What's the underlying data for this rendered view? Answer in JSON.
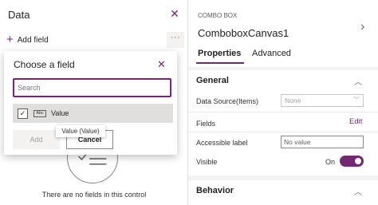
{
  "data_pane": {
    "title": "Data",
    "add_field_label": "Add field",
    "more_label": "···",
    "empty_text": "There are no fields in this control"
  },
  "dialog": {
    "title": "Choose a field",
    "search_placeholder": "Search",
    "field_type": "Abc",
    "field_label": "Value",
    "checked": "✓",
    "add_label": "Add",
    "cancel_label": "Cancel",
    "tooltip": "Value (Value)"
  },
  "properties": {
    "control_type": "COMBO BOX",
    "control_name": "ComboboxCanvas1",
    "tabs": [
      {
        "label": "Properties",
        "active": true
      },
      {
        "label": "Advanced",
        "active": false
      }
    ],
    "general": {
      "title": "General",
      "data_source_label": "Data Source(Items)",
      "data_source_value": "None",
      "fields_label": "Fields",
      "fields_action": "Edit",
      "accessible_label": "Accessible label",
      "accessible_value": "No value",
      "visible_label": "Visible",
      "visible_state": "On"
    },
    "behavior": {
      "title": "Behavior"
    }
  },
  "colors": {
    "accent": "#742774",
    "pane_background": "#f3f2f1"
  },
  "icons": [
    "close-icon",
    "add-icon",
    "more-icon",
    "chevron-right-icon",
    "chevron-up-icon",
    "chevron-down-icon",
    "checkmark-icon",
    "text-type-icon",
    "empty-list-icon"
  ]
}
